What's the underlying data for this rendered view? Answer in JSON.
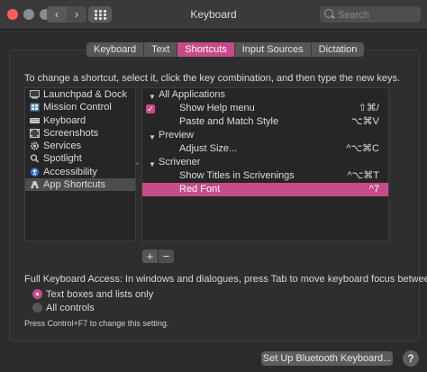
{
  "window": {
    "title": "Keyboard"
  },
  "search": {
    "placeholder": "Search"
  },
  "tabs": [
    {
      "label": "Keyboard"
    },
    {
      "label": "Text"
    },
    {
      "label": "Shortcuts",
      "active": true
    },
    {
      "label": "Input Sources"
    },
    {
      "label": "Dictation"
    }
  ],
  "instructions": "To change a shortcut, select it, click the key combination, and then type the new keys.",
  "categories": [
    {
      "label": "Launchpad & Dock",
      "icon": "launchpad-dock-icon"
    },
    {
      "label": "Mission Control",
      "icon": "mission-control-icon"
    },
    {
      "label": "Keyboard",
      "icon": "keyboard-icon"
    },
    {
      "label": "Screenshots",
      "icon": "screenshots-icon"
    },
    {
      "label": "Services",
      "icon": "services-gear-icon"
    },
    {
      "label": "Spotlight",
      "icon": "spotlight-icon"
    },
    {
      "label": "Accessibility",
      "icon": "accessibility-icon"
    },
    {
      "label": "App Shortcuts",
      "icon": "app-shortcuts-icon",
      "selected": true
    }
  ],
  "shortcuts": {
    "all_applications": {
      "label": "All Applications",
      "items": [
        {
          "label": "Show Help menu",
          "key": "⇧⌘/",
          "checked": true
        },
        {
          "label": "Paste and Match Style",
          "key": "⌥⌘V"
        }
      ]
    },
    "preview": {
      "label": "Preview",
      "items": [
        {
          "label": "Adjust Size...",
          "key": "^⌥⌘C"
        }
      ]
    },
    "scrivener": {
      "label": "Scrivener",
      "items": [
        {
          "label": "Show Titles in Scrivenings",
          "key": "^⌥⌘T"
        },
        {
          "label": "Red Font",
          "key": "^7",
          "selected": true
        }
      ]
    }
  },
  "buttons": {
    "add": "+",
    "remove": "−",
    "bluetooth": "Set Up Bluetooth Keyboard...",
    "help": "?"
  },
  "full_keyboard_access": {
    "label": "Full Keyboard Access: In windows and dialogues, press Tab to move keyboard focus between:",
    "options": [
      {
        "label": "Text boxes and lists only",
        "selected": true
      },
      {
        "label": "All controls",
        "selected": false
      }
    ],
    "hint": "Press Control+F7 to change this setting."
  },
  "colors": {
    "accent": "#c74b8a",
    "background": "#2b2b2b"
  }
}
